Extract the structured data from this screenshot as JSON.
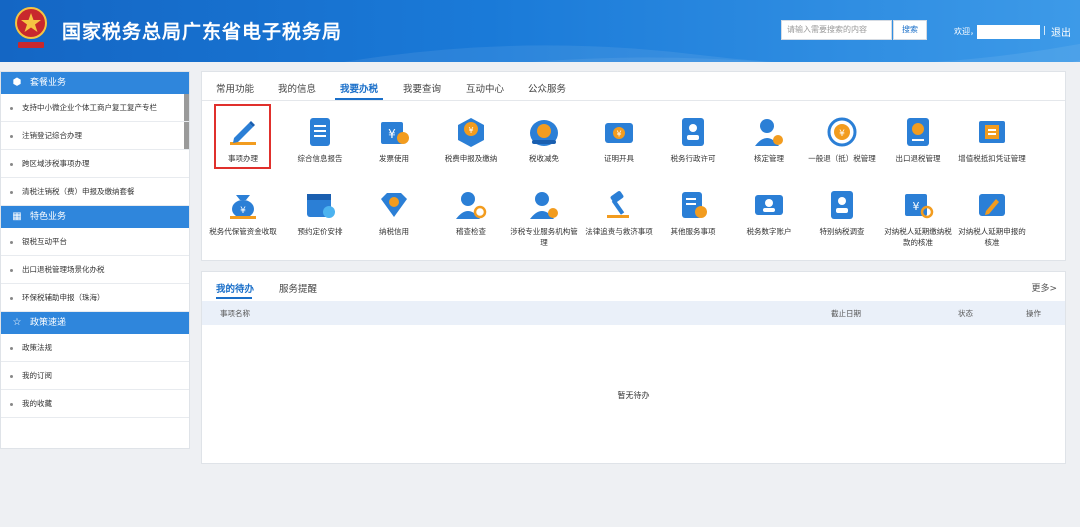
{
  "header": {
    "title": "国家税务总局广东省电子税务局",
    "search_placeholder": "请输入需要搜索的内容",
    "search_button": "搜索",
    "welcome": "欢迎，",
    "separator": "|",
    "logout": "退出",
    "emblem_icon": "tax-emblem-icon",
    "colors": {
      "bar": "#1a7ad8"
    }
  },
  "sidebar": {
    "sections": [
      {
        "title": "套餐业务",
        "icon": "cube-icon",
        "items": [
          "支持中小微企业个体工商户复工复产专栏",
          "注销登记综合办理",
          "跨区域涉税事项办理",
          "清税注销税（费）申报及缴纳套餐"
        ]
      },
      {
        "title": "特色业务",
        "icon": "grid-icon",
        "items": [
          "银税互动平台",
          "出口退税管理场景化办税",
          "环保税辅助申报（珠海）"
        ]
      },
      {
        "title": "政策速递",
        "icon": "star-icon",
        "items": [
          "政策法规",
          "我的订阅",
          "我的收藏"
        ]
      }
    ]
  },
  "main": {
    "tabs": [
      "常用功能",
      "我的信息",
      "我要办税",
      "我要查询",
      "互动中心",
      "公众服务"
    ],
    "active_tab": "我要办税",
    "tiles": [
      {
        "label": "事项办理",
        "icon": "pencil-icon",
        "highlighted": true
      },
      {
        "label": "综合信息报告",
        "icon": "document-list-icon"
      },
      {
        "label": "发票使用",
        "icon": "invoice-icon"
      },
      {
        "label": "税费申报及缴纳",
        "icon": "tax-declare-icon"
      },
      {
        "label": "税收减免",
        "icon": "tax-reduction-icon"
      },
      {
        "label": "证明开具",
        "icon": "certificate-icon"
      },
      {
        "label": "税务行政许可",
        "icon": "license-icon"
      },
      {
        "label": "核定管理",
        "icon": "user-gear-icon"
      },
      {
        "label": "一般退（抵）税管理",
        "icon": "refund-icon"
      },
      {
        "label": "出口退税管理",
        "icon": "export-refund-icon"
      },
      {
        "label": "增值税抵扣凭证管理",
        "icon": "vat-voucher-icon"
      },
      {
        "label": "税务代保管资金收取",
        "icon": "money-bag-icon"
      },
      {
        "label": "预约定价安排",
        "icon": "calendar-icon"
      },
      {
        "label": "纳税信用",
        "icon": "credit-diamond-icon"
      },
      {
        "label": "稽查检查",
        "icon": "inspect-icon"
      },
      {
        "label": "涉税专业服务机构管理",
        "icon": "agency-icon"
      },
      {
        "label": "法律追责与救济事项",
        "icon": "gavel-icon"
      },
      {
        "label": "其他服务事项",
        "icon": "other-service-icon"
      },
      {
        "label": "税务数字账户",
        "icon": "digital-account-icon"
      },
      {
        "label": "特别纳税调查",
        "icon": "special-survey-icon"
      },
      {
        "label": "对纳税人延期缴纳税款的核准",
        "icon": "deferred-payment-icon"
      },
      {
        "label": "对纳税人延期申报的核准",
        "icon": "deferred-declare-icon"
      }
    ]
  },
  "todo": {
    "tabs": [
      "我的待办",
      "服务提醒"
    ],
    "more": "更多>",
    "columns": [
      "事项名称",
      "截止日期",
      "状态",
      "操作"
    ],
    "empty_text": "暂无待办"
  }
}
